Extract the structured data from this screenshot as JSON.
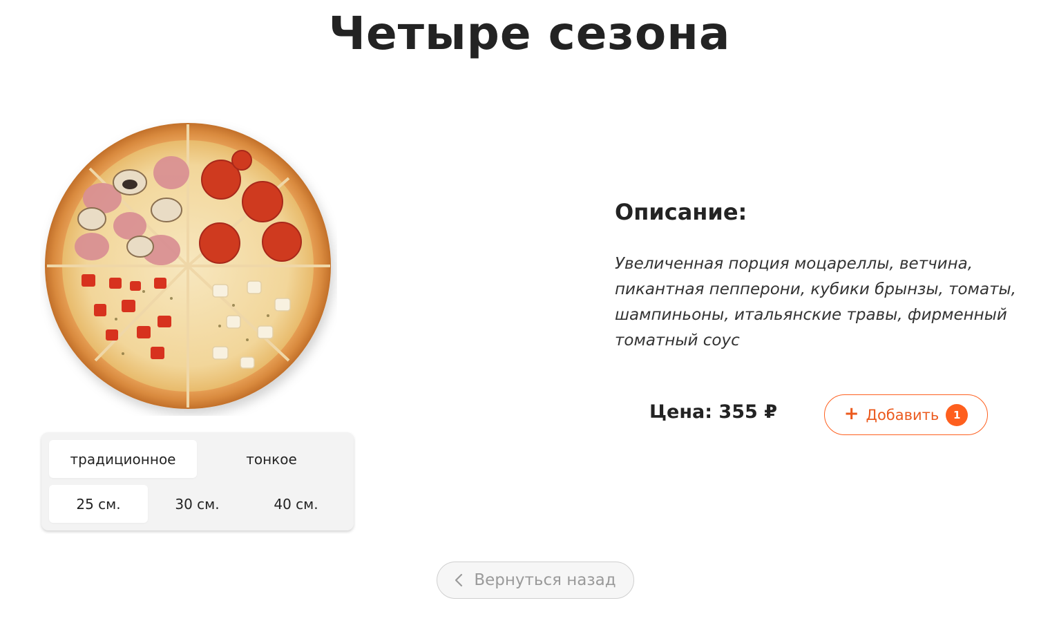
{
  "product": {
    "title": "Четыре сезона"
  },
  "options": {
    "dough": [
      {
        "label": "традиционное",
        "active": true
      },
      {
        "label": "тонкое",
        "active": false
      }
    ],
    "sizes": [
      {
        "label": "25 см.",
        "active": true
      },
      {
        "label": "30 см.",
        "active": false
      },
      {
        "label": "40 см.",
        "active": false
      }
    ]
  },
  "description": {
    "heading": "Описание:",
    "text": "Увеличенная порция моцареллы, ветчина, пикантная пепперони, кубики брынзы, томаты, шампиньоны, итальянские травы, фирменный томатный соус"
  },
  "price": {
    "label": "Цена: 355 ₽"
  },
  "add_button": {
    "plus": "+",
    "label": "Добавить",
    "count": "1"
  },
  "back_button": {
    "label": "Вернуться назад"
  },
  "icons": {
    "pizza": "pizza-image",
    "plus": "plus-icon",
    "back": "chevron-left-icon"
  },
  "colors": {
    "accent": "#fe5f1e",
    "text": "#232323",
    "muted": "#9a9a9a"
  }
}
